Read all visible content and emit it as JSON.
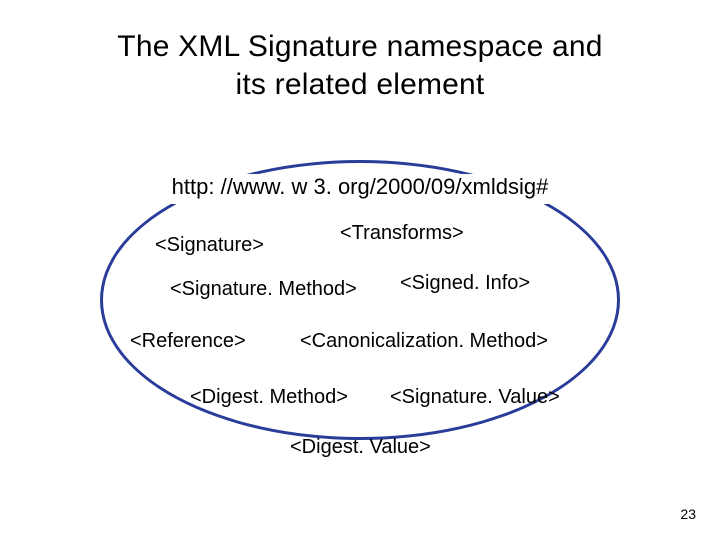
{
  "title_line1": "The XML Signature namespace and",
  "title_line2": "its related element",
  "namespace": "http: //www. w 3. org/2000/09/xmldsig#",
  "elements": {
    "signature": "<Signature>",
    "transforms": "<Transforms>",
    "signatureMethod": "<Signature. Method>",
    "signedInfo": "<Signed. Info>",
    "reference": "<Reference>",
    "canonicalizationMethod": "<Canonicalization. Method>",
    "digestMethod": "<Digest. Method>",
    "signatureValue": "<Signature. Value>",
    "digestValue": "<Digest. Value>"
  },
  "pageNumber": "23"
}
